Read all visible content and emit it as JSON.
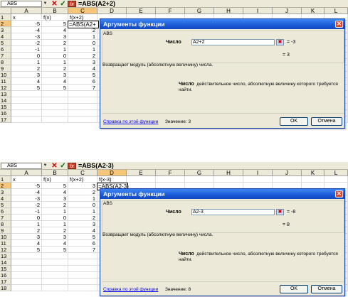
{
  "panels": [
    {
      "name_box": "ABS",
      "formula": "=ABS(A2+2)",
      "columns": [
        "A",
        "B",
        "C",
        "D",
        "E",
        "F",
        "G",
        "H",
        "I",
        "J",
        "K",
        "L"
      ],
      "selected_col": "C",
      "selected_row": "2",
      "rows": [
        "1",
        "2",
        "3",
        "4",
        "5",
        "6",
        "7",
        "8",
        "9",
        "10",
        "11",
        "12",
        "13",
        "14",
        "15",
        "16",
        "17"
      ],
      "cells": {
        "A": [
          "x",
          "-5",
          "-4",
          "-3",
          "-2",
          "-1",
          "0",
          "1",
          "2",
          "3",
          "4",
          "5",
          "",
          "",
          "",
          "",
          ""
        ],
        "B": [
          "f(x)",
          "5",
          "4",
          "3",
          "2",
          "1",
          "0",
          "1",
          "2",
          "3",
          "4",
          "5",
          "",
          "",
          "",
          "",
          ""
        ],
        "C": [
          "f(x+2)",
          "",
          "2",
          "1",
          "0",
          "1",
          "2",
          "3",
          "4",
          "5",
          "6",
          "7",
          "",
          "",
          "",
          "",
          ""
        ]
      },
      "edit_text": "=ABS(A2+",
      "dialog": {
        "title": "Аргументы функции",
        "function_name": "ABS",
        "arg_label": "Число",
        "arg_input": "A2+2",
        "arg_value": "= -3",
        "result": "= 3",
        "description": "Возвращает модуль (абсолютную величину) числа.",
        "arg_desc_label": "Число",
        "arg_desc_text": "действительное число, абсолютную величину которого требуется найти.",
        "help_link": "Справка по этой функции",
        "value_label": "Значение:",
        "value": "3",
        "ok": "OK",
        "cancel": "Отмена"
      }
    },
    {
      "name_box": "ABS",
      "formula": "=ABS(A2-3)",
      "columns": [
        "A",
        "B",
        "C",
        "D",
        "E",
        "F",
        "G",
        "H",
        "I",
        "J",
        "K",
        "L"
      ],
      "selected_col": "D",
      "selected_row": "2",
      "rows": [
        "1",
        "2",
        "3",
        "4",
        "5",
        "6",
        "7",
        "8",
        "9",
        "10",
        "11",
        "12",
        "13",
        "14",
        "15",
        "16",
        "17",
        "18"
      ],
      "cells": {
        "A": [
          "x",
          "-5",
          "-4",
          "-3",
          "-2",
          "-1",
          "0",
          "1",
          "2",
          "3",
          "4",
          "5",
          "",
          "",
          "",
          "",
          "",
          ""
        ],
        "B": [
          "f(x)",
          "5",
          "4",
          "3",
          "2",
          "1",
          "0",
          "1",
          "2",
          "3",
          "4",
          "5",
          "",
          "",
          "",
          "",
          "",
          ""
        ],
        "C": [
          "f(x+2)",
          "3",
          "2",
          "1",
          "0",
          "1",
          "2",
          "3",
          "4",
          "5",
          "6",
          "7",
          "",
          "",
          "",
          "",
          "",
          ""
        ],
        "D": [
          "f(x-3)",
          "",
          "",
          "",
          "",
          "",
          "",
          "",
          "",
          "",
          "",
          "",
          "",
          "",
          "",
          "",
          "",
          ""
        ]
      },
      "edit_text": "=ABS(A2-3)",
      "dialog": {
        "title": "Аргументы функции",
        "function_name": "ABS",
        "arg_label": "Число",
        "arg_input": "A2-3",
        "arg_value": "= -8",
        "result": "= 8",
        "description": "Возвращает модуль (абсолютную величину) числа.",
        "arg_desc_label": "Число",
        "arg_desc_text": "действительное число, абсолютную величину которого требуется найти.",
        "help_link": "Справка по этой функции",
        "value_label": "Значение:",
        "value": "8",
        "ok": "OK",
        "cancel": "Отмена"
      }
    }
  ]
}
